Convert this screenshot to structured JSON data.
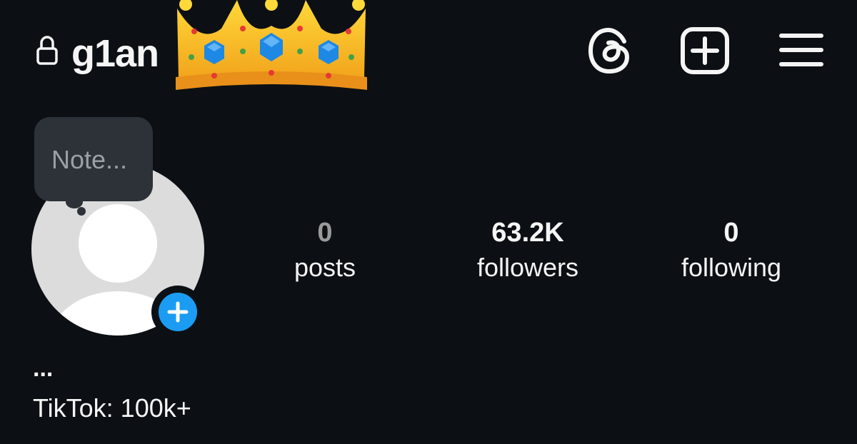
{
  "header": {
    "username": "g1an",
    "icons": {
      "lock": "lock-icon",
      "crown": "crown-emoji",
      "threads": "threads-icon",
      "create": "plus-square-icon",
      "menu": "hamburger-menu-icon"
    }
  },
  "note": {
    "placeholder": "Note..."
  },
  "profile": {
    "avatar": "default-avatar",
    "add_story_icon": "plus-icon",
    "add_story_color": "#1b9cf2"
  },
  "stats": {
    "posts": {
      "value": "0",
      "label": "posts"
    },
    "followers": {
      "value": "63.2K",
      "label": "followers"
    },
    "following": {
      "value": "0",
      "label": "following"
    }
  },
  "bio": {
    "name": "...",
    "text": "TikTok: 100k+"
  },
  "colors": {
    "background": "#0c1014",
    "text": "#f5f5f5",
    "muted": "#9aa0a6",
    "bubble": "#2d3238"
  }
}
